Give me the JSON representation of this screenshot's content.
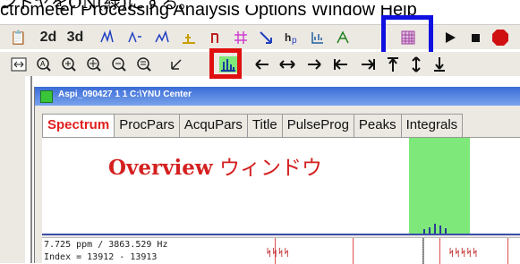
{
  "caption": {
    "text": "ントヤをON(緑)にする。",
    "menu": "ctrometer Processing Analysis Options Window Help"
  },
  "toolbar1": {
    "labels": {
      "two_d": "2d",
      "three_d": "3d"
    }
  },
  "window": {
    "title": "Aspi_090427 1 1 C:\\YNU Center"
  },
  "tabs": [
    "Spectrum",
    "ProcPars",
    "AcquPars",
    "Title",
    "PulseProg",
    "Peaks",
    "Integrals"
  ],
  "spectrum": {
    "overlay_bold": "Overview",
    "overlay_rest": " ウィンドウ",
    "info_line1": "7.725 ppm / 3863.529 Hz",
    "info_line2": "Index = 13912 - 13913"
  },
  "colors": {
    "highlight_red": "#e01010",
    "highlight_blue": "#1010e0",
    "overview_green": "#7ee87a"
  }
}
